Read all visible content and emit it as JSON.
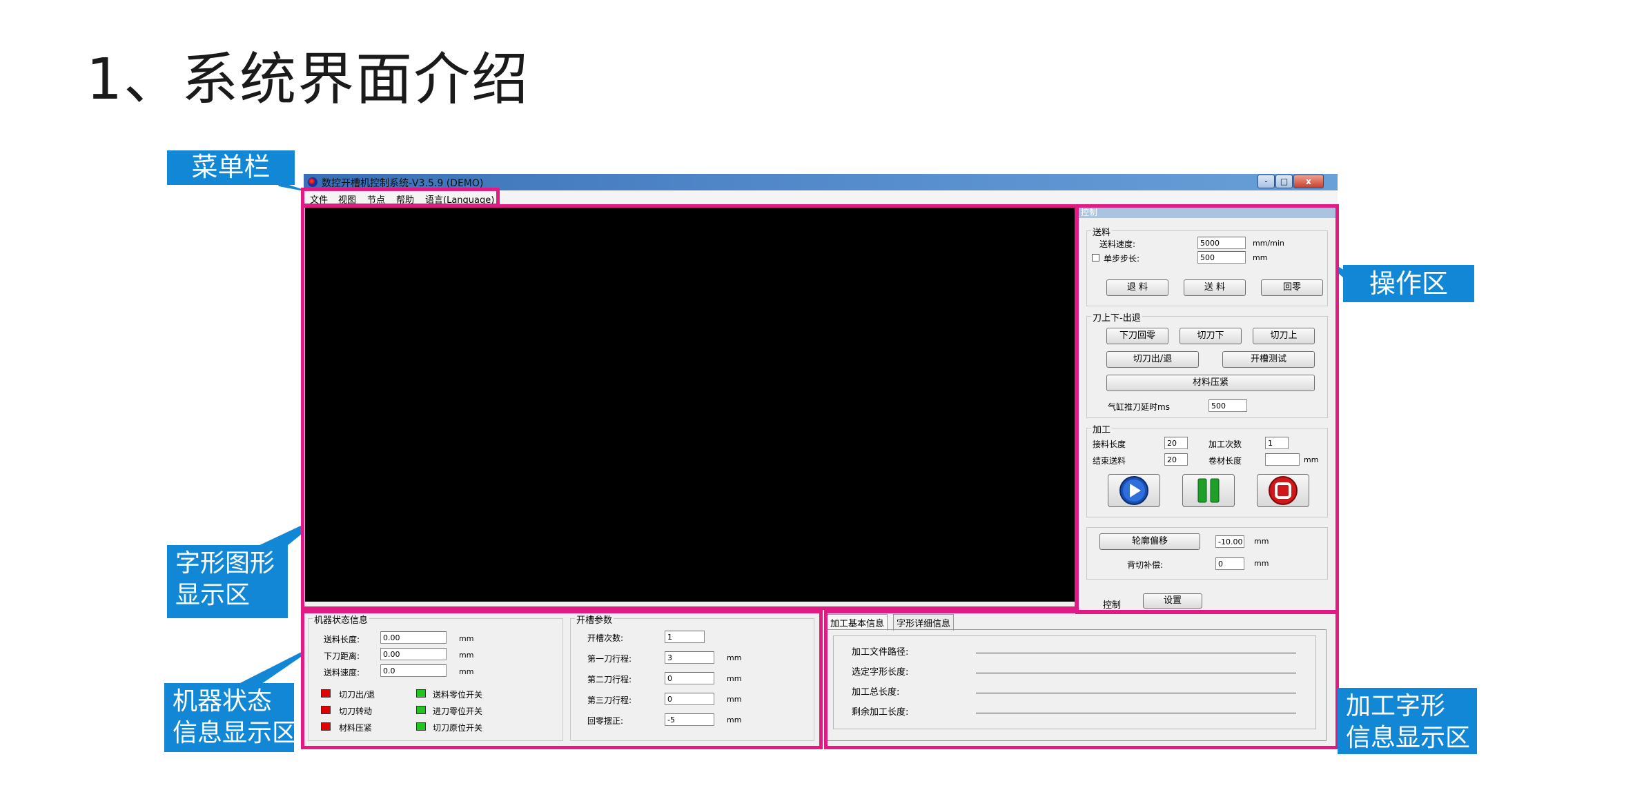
{
  "slide": {
    "title": "1、系统界面介绍"
  },
  "callouts": {
    "menubar": "菜单栏",
    "ops": "操作区",
    "glyph_line1": "字形图形",
    "glyph_line2": "显示区",
    "machine_line1": "机器状态",
    "machine_line2": "信息显示区",
    "process_line1": "加工字形",
    "process_line2": "信息显示区"
  },
  "colors": {
    "highlight": "#e01c84",
    "callout_bg": "#1187d6",
    "led_red": "#e00000",
    "led_green": "#22c422"
  },
  "window": {
    "title": "数控开槽机控制系统-V3.5.9 (DEMO)",
    "menu": [
      "文件",
      "视图",
      "节点",
      "帮助",
      "语言(Language)"
    ],
    "controls": {
      "min": "-",
      "max": "□",
      "close": "x"
    }
  },
  "control_panel": {
    "header": "控制",
    "feed": {
      "title": "送料",
      "speed_label": "送料速度:",
      "speed_value": "5000",
      "speed_unit": "mm/min",
      "step_label": "单步步长:",
      "step_value": "500",
      "step_unit": "mm",
      "btn_back": "退 料",
      "btn_feed": "送 料",
      "btn_home": "回零"
    },
    "knife": {
      "title": "刀上下-出退",
      "btn_lower_home": "下刀回零",
      "btn_cut_down": "切刀下",
      "btn_cut_up": "切刀上",
      "btn_cut_out": "切刀出/退",
      "btn_slot_test": "开槽测试",
      "btn_press": "材料压紧",
      "delay_label": "气缸推刀延时ms",
      "delay_value": "500"
    },
    "process": {
      "title": "加工",
      "joint_label": "接料长度",
      "joint_value": "20",
      "count_label": "加工次数",
      "count_value": "1",
      "end_label": "结束送料",
      "end_value": "20",
      "roll_label": "卷材长度",
      "roll_value": "",
      "roll_unit": "mm"
    },
    "offset": {
      "btn_contour": "轮廓偏移",
      "contour_value": "-10.00",
      "contour_unit": "mm",
      "back_label": "背切补偿:",
      "back_value": "0",
      "back_unit": "mm"
    },
    "footer": {
      "label": "控制",
      "btn_settings": "设置"
    }
  },
  "machine_status": {
    "title": "机器状态信息",
    "rows": [
      {
        "label": "送料长度:",
        "value": "0.00",
        "unit": "mm"
      },
      {
        "label": "下刀距离:",
        "value": "0.00",
        "unit": "mm"
      },
      {
        "label": "送料速度:",
        "value": "0.0",
        "unit": "mm"
      }
    ],
    "indicators": [
      {
        "label": "切刀出/退",
        "color": "red"
      },
      {
        "label": "切刀转动",
        "color": "red"
      },
      {
        "label": "材料压紧",
        "color": "red"
      },
      {
        "label": "送料零位开关",
        "color": "green"
      },
      {
        "label": "进刀零位开关",
        "color": "green"
      },
      {
        "label": "切刀原位开关",
        "color": "green"
      }
    ]
  },
  "slot_params": {
    "title": "开槽参数",
    "rows": [
      {
        "label": "开槽次数:",
        "value": "1",
        "unit": ""
      },
      {
        "label": "第一刀行程:",
        "value": "3",
        "unit": "mm"
      },
      {
        "label": "第二刀行程:",
        "value": "0",
        "unit": "mm"
      },
      {
        "label": "第三刀行程:",
        "value": "0",
        "unit": "mm"
      },
      {
        "label": "回零摆正:",
        "value": "-5",
        "unit": "mm"
      }
    ]
  },
  "process_info": {
    "tabs": [
      "加工基本信息",
      "字形详细信息"
    ],
    "rows": [
      "加工文件路径:",
      "选定字形长度:",
      "加工总长度:",
      "剩余加工长度:"
    ]
  }
}
